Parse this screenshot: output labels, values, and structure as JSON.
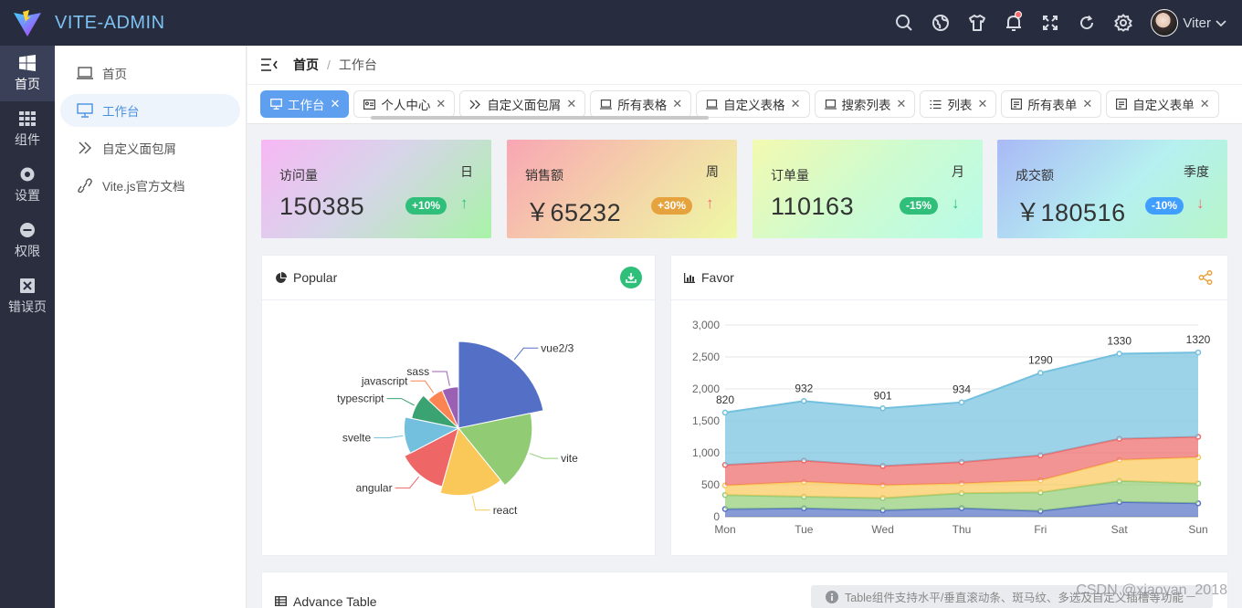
{
  "app": {
    "title": "VITE-ADMIN"
  },
  "topbar": {
    "user_name": "Viter"
  },
  "rail": {
    "items": [
      {
        "label": "首页",
        "icon": "windows-icon",
        "active": true
      },
      {
        "label": "组件",
        "icon": "grid-icon"
      },
      {
        "label": "设置",
        "icon": "gear-icon"
      },
      {
        "label": "权限",
        "icon": "minus-circle-icon"
      },
      {
        "label": "错误页",
        "icon": "close-square-icon"
      }
    ]
  },
  "submenu": {
    "items": [
      {
        "label": "首页",
        "icon": "monitor-icon"
      },
      {
        "label": "工作台",
        "icon": "monitor-icon",
        "active": true
      },
      {
        "label": "自定义面包屑",
        "icon": "double-chevron-icon"
      },
      {
        "label": "Vite.js官方文档",
        "icon": "link-icon"
      }
    ]
  },
  "breadcrumb": {
    "home": "首页",
    "current": "工作台"
  },
  "tabs": [
    {
      "label": "工作台",
      "active": true
    },
    {
      "label": "个人中心"
    },
    {
      "label": "自定义面包屑"
    },
    {
      "label": "所有表格"
    },
    {
      "label": "自定义表格"
    },
    {
      "label": "搜索列表"
    },
    {
      "label": "列表"
    },
    {
      "label": "所有表单"
    },
    {
      "label": "自定义表单"
    }
  ],
  "stats": [
    {
      "name": "访问量",
      "period": "日",
      "value": "150385",
      "change": "+10%",
      "trend": "up",
      "badge_color": "#2fbf7a",
      "arrow_color": "#2fbf7a"
    },
    {
      "name": "销售额",
      "period": "周",
      "value": "￥65232",
      "change": "+30%",
      "trend": "up",
      "badge_color": "#e6a23c",
      "arrow_color": "#f56c6c"
    },
    {
      "name": "订单量",
      "period": "月",
      "value": "110163",
      "change": "-15%",
      "trend": "down",
      "badge_color": "#2fbf7a",
      "arrow_color": "#2fbf7a"
    },
    {
      "name": "成交额",
      "period": "季度",
      "value": "￥180516",
      "change": "-10%",
      "trend": "down",
      "badge_color": "#409eff",
      "arrow_color": "#f56c6c"
    }
  ],
  "popular_panel": {
    "title": "Popular"
  },
  "favor_panel": {
    "title": "Favor"
  },
  "advance_panel": {
    "title": "Advance Table",
    "notice": "Table组件支持水平/垂直滚动条、斑马纹、多选及自定义插槽等功能"
  },
  "watermark": "CSDN @xiaoyan_2018",
  "chart_data": [
    {
      "type": "pie",
      "title": "Popular",
      "rose": true,
      "slices": [
        {
          "label": "vue2/3",
          "value": 100,
          "color": "#5470c6"
        },
        {
          "label": "vite",
          "value": 80,
          "color": "#91cc75"
        },
        {
          "label": "react",
          "value": 70,
          "color": "#fac858"
        },
        {
          "label": "angular",
          "value": 60,
          "color": "#ee6666"
        },
        {
          "label": "svelte",
          "value": 50,
          "color": "#73c0de"
        },
        {
          "label": "typescript",
          "value": 40,
          "color": "#3ba272"
        },
        {
          "label": "javascript",
          "value": 30,
          "color": "#fc8452"
        },
        {
          "label": "sass",
          "value": 30,
          "color": "#9a60b4"
        }
      ]
    },
    {
      "type": "area",
      "title": "Favor",
      "stacked": true,
      "categories": [
        "Mon",
        "Tue",
        "Wed",
        "Thu",
        "Fri",
        "Sat",
        "Sun"
      ],
      "ylim": [
        0,
        3000
      ],
      "yticks": [
        "0",
        "500",
        "1,000",
        "1,500",
        "2,000",
        "2,500",
        "3,000"
      ],
      "grid": true,
      "series": [
        {
          "values": [
            120,
            132,
            101,
            134,
            90,
            230,
            210
          ],
          "color": "#5470c6"
        },
        {
          "values": [
            220,
            182,
            191,
            234,
            290,
            330,
            310
          ],
          "color": "#91cc75"
        },
        {
          "values": [
            150,
            232,
            201,
            154,
            190,
            330,
            410
          ],
          "color": "#fac858"
        },
        {
          "values": [
            320,
            332,
            301,
            334,
            390,
            330,
            320
          ],
          "color": "#ee6666"
        },
        {
          "values": [
            820,
            932,
            901,
            934,
            1290,
            1330,
            1320
          ],
          "color": "#73c0de"
        }
      ],
      "top_labels": [
        "820",
        "932",
        "901",
        "934",
        "1290",
        "1330",
        "1320"
      ]
    }
  ]
}
